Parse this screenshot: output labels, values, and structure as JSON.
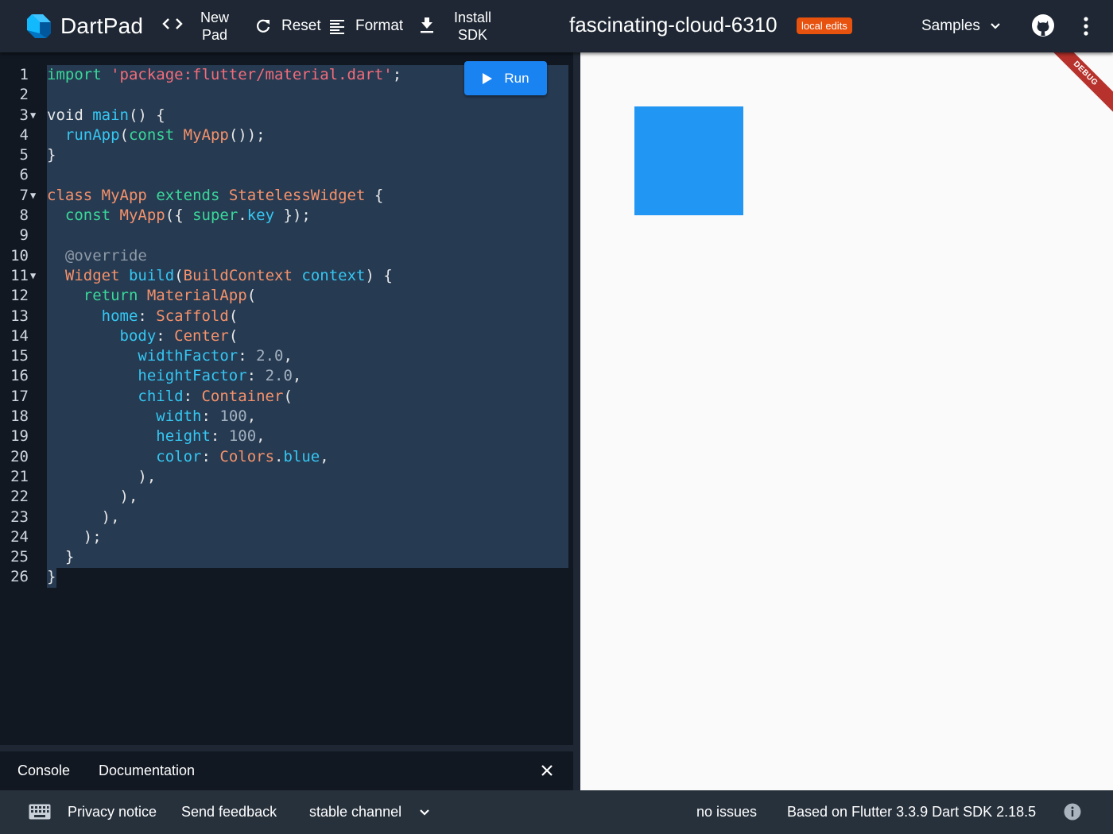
{
  "header": {
    "app_name": "DartPad",
    "new_pad_line1": "New",
    "new_pad_line2": "Pad",
    "reset_label": "Reset",
    "format_label": "Format",
    "install_line1": "Install",
    "install_line2": "SDK",
    "pad_title": "fascinating-cloud-6310",
    "badge": "local edits",
    "samples_label": "Samples"
  },
  "editor": {
    "run_label": "Run",
    "lines": [
      {
        "n": "1",
        "fold": false
      },
      {
        "n": "2",
        "fold": false
      },
      {
        "n": "3",
        "fold": true
      },
      {
        "n": "4",
        "fold": false
      },
      {
        "n": "5",
        "fold": false
      },
      {
        "n": "6",
        "fold": false
      },
      {
        "n": "7",
        "fold": true
      },
      {
        "n": "8",
        "fold": false
      },
      {
        "n": "9",
        "fold": false
      },
      {
        "n": "10",
        "fold": false
      },
      {
        "n": "11",
        "fold": true
      },
      {
        "n": "12",
        "fold": false
      },
      {
        "n": "13",
        "fold": false
      },
      {
        "n": "14",
        "fold": false
      },
      {
        "n": "15",
        "fold": false
      },
      {
        "n": "16",
        "fold": false
      },
      {
        "n": "17",
        "fold": false
      },
      {
        "n": "18",
        "fold": false
      },
      {
        "n": "19",
        "fold": false
      },
      {
        "n": "20",
        "fold": false
      },
      {
        "n": "21",
        "fold": false
      },
      {
        "n": "22",
        "fold": false
      },
      {
        "n": "23",
        "fold": false
      },
      {
        "n": "24",
        "fold": false
      },
      {
        "n": "25",
        "fold": false
      },
      {
        "n": "26",
        "fold": false
      }
    ],
    "code": [
      [
        {
          "t": "import",
          "c": "kw-g"
        },
        {
          "t": " "
        },
        {
          "t": "'package:flutter/material.dart'",
          "c": "str"
        },
        {
          "t": ";"
        }
      ],
      [],
      [
        {
          "t": "void "
        },
        {
          "t": "main",
          "c": "kw-c"
        },
        {
          "t": "() {"
        }
      ],
      [
        {
          "t": "  "
        },
        {
          "t": "runApp",
          "c": "kw-c"
        },
        {
          "t": "("
        },
        {
          "t": "const",
          "c": "kw-g"
        },
        {
          "t": " "
        },
        {
          "t": "MyApp",
          "c": "kw-o"
        },
        {
          "t": "());"
        }
      ],
      [
        {
          "t": "}"
        }
      ],
      [],
      [
        {
          "t": "class",
          "c": "kw-o"
        },
        {
          "t": " "
        },
        {
          "t": "MyApp",
          "c": "kw-o"
        },
        {
          "t": " "
        },
        {
          "t": "extends",
          "c": "kw-g"
        },
        {
          "t": " "
        },
        {
          "t": "StatelessWidget",
          "c": "kw-o"
        },
        {
          "t": " {"
        }
      ],
      [
        {
          "t": "  "
        },
        {
          "t": "const",
          "c": "kw-g"
        },
        {
          "t": " "
        },
        {
          "t": "MyApp",
          "c": "kw-o"
        },
        {
          "t": "({ "
        },
        {
          "t": "super",
          "c": "kw-g"
        },
        {
          "t": "."
        },
        {
          "t": "key",
          "c": "kw-c"
        },
        {
          "t": " });"
        }
      ],
      [],
      [
        {
          "t": "  "
        },
        {
          "t": "@override",
          "c": "ann"
        }
      ],
      [
        {
          "t": "  "
        },
        {
          "t": "Widget",
          "c": "kw-o"
        },
        {
          "t": " "
        },
        {
          "t": "build",
          "c": "kw-c"
        },
        {
          "t": "("
        },
        {
          "t": "BuildContext",
          "c": "kw-o"
        },
        {
          "t": " "
        },
        {
          "t": "context",
          "c": "kw-c"
        },
        {
          "t": ") {"
        }
      ],
      [
        {
          "t": "    "
        },
        {
          "t": "return",
          "c": "kw-g"
        },
        {
          "t": " "
        },
        {
          "t": "MaterialApp",
          "c": "kw-o"
        },
        {
          "t": "("
        }
      ],
      [
        {
          "t": "      "
        },
        {
          "t": "home",
          "c": "kw-c"
        },
        {
          "t": ": "
        },
        {
          "t": "Scaffold",
          "c": "kw-o"
        },
        {
          "t": "("
        }
      ],
      [
        {
          "t": "        "
        },
        {
          "t": "body",
          "c": "kw-c"
        },
        {
          "t": ": "
        },
        {
          "t": "Center",
          "c": "kw-o"
        },
        {
          "t": "("
        }
      ],
      [
        {
          "t": "          "
        },
        {
          "t": "widthFactor",
          "c": "kw-c"
        },
        {
          "t": ": "
        },
        {
          "t": "2.0",
          "c": "num"
        },
        {
          "t": ","
        }
      ],
      [
        {
          "t": "          "
        },
        {
          "t": "heightFactor",
          "c": "kw-c"
        },
        {
          "t": ": "
        },
        {
          "t": "2.0",
          "c": "num"
        },
        {
          "t": ","
        }
      ],
      [
        {
          "t": "          "
        },
        {
          "t": "child",
          "c": "kw-c"
        },
        {
          "t": ": "
        },
        {
          "t": "Container",
          "c": "kw-o"
        },
        {
          "t": "("
        }
      ],
      [
        {
          "t": "            "
        },
        {
          "t": "width",
          "c": "kw-c"
        },
        {
          "t": ": "
        },
        {
          "t": "100",
          "c": "num"
        },
        {
          "t": ","
        }
      ],
      [
        {
          "t": "            "
        },
        {
          "t": "height",
          "c": "kw-c"
        },
        {
          "t": ": "
        },
        {
          "t": "100",
          "c": "num"
        },
        {
          "t": ","
        }
      ],
      [
        {
          "t": "            "
        },
        {
          "t": "color",
          "c": "kw-c"
        },
        {
          "t": ": "
        },
        {
          "t": "Colors",
          "c": "kw-o"
        },
        {
          "t": "."
        },
        {
          "t": "blue",
          "c": "kw-c"
        },
        {
          "t": ","
        }
      ],
      [
        {
          "t": "          ),"
        }
      ],
      [
        {
          "t": "        ),"
        }
      ],
      [
        {
          "t": "      ),"
        }
      ],
      [
        {
          "t": "    );"
        }
      ],
      [
        {
          "t": "  }"
        }
      ],
      [
        {
          "t": "}"
        }
      ]
    ]
  },
  "console": {
    "tab_console": "Console",
    "tab_docs": "Documentation"
  },
  "output": {
    "debug_label": "DEBUG",
    "box_color": "#2196f3"
  },
  "footer": {
    "privacy": "Privacy notice",
    "feedback": "Send feedback",
    "channel": "stable channel",
    "issues": "no issues",
    "version": "Based on Flutter 3.3.9 Dart SDK 2.18.5"
  }
}
